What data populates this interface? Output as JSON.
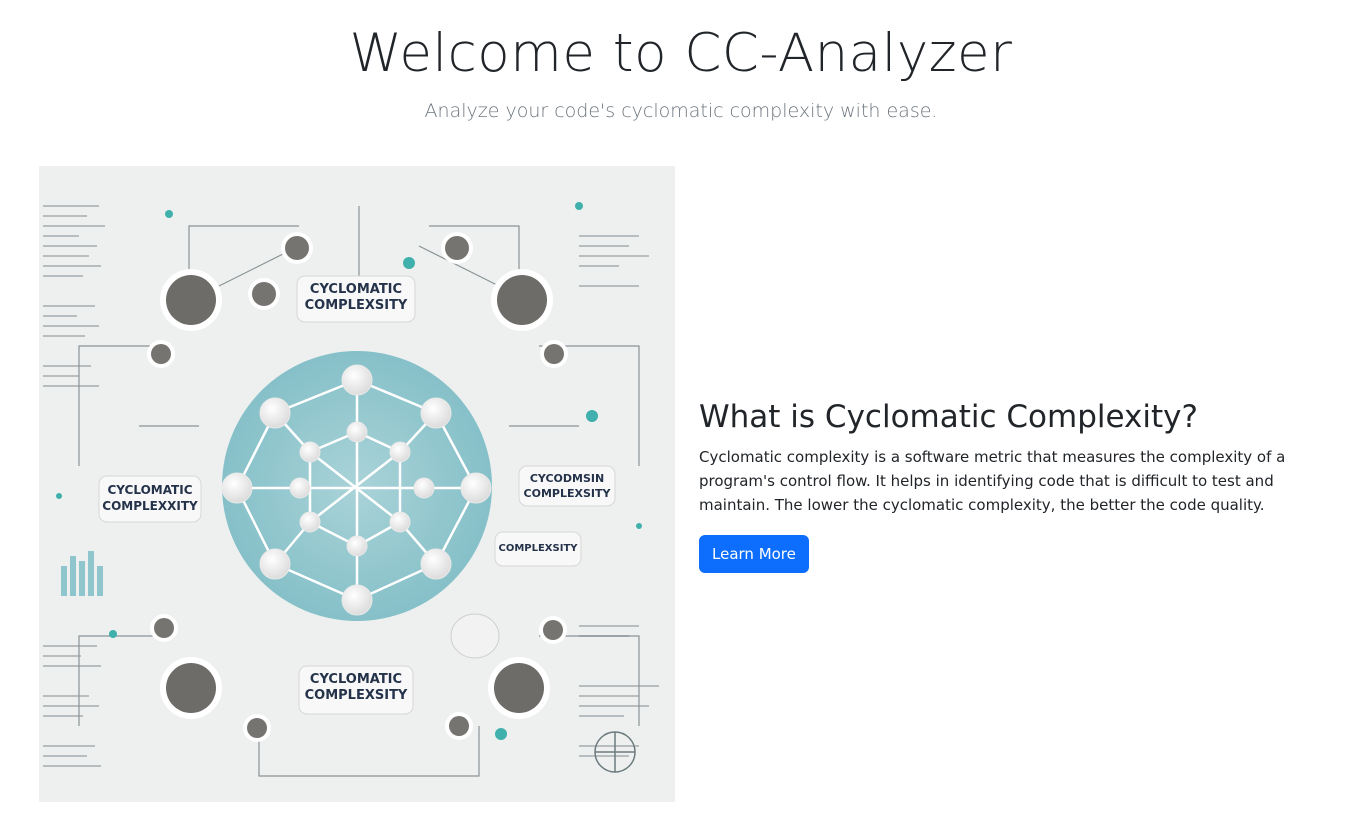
{
  "hero": {
    "title": "Welcome to CC-Analyzer",
    "subtitle": "Analyze your code's cyclomatic complexity with ease."
  },
  "illustration": {
    "labels": {
      "top": "CYCLOMATIC COMPLEXSITY",
      "left": "CYCLOMATIC COMPLEXXITY",
      "right": "CYCODMSIN COMPLEXSITY",
      "right_lower": "COMPLEXSITY",
      "bottom": "CYCLOMATIC COMPLEXSITY"
    },
    "colors": {
      "teal": "#8fc6cd",
      "node_dark": "#6d6c68",
      "background": "#eef0f0"
    }
  },
  "info": {
    "heading": "What is Cyclomatic Complexity?",
    "body": "Cyclomatic complexity is a software metric that measures the complexity of a program's control flow. It helps in identifying code that is difficult to test and maintain. The lower the cyclomatic complexity, the better the code quality.",
    "button_label": "Learn More"
  },
  "colors": {
    "primary": "#0d6efd",
    "muted": "#6c757d"
  }
}
